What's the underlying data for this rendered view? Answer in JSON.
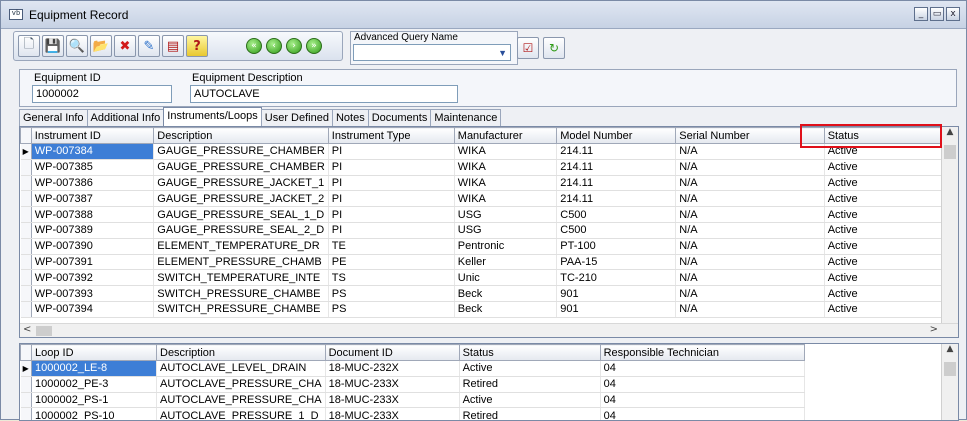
{
  "window": {
    "title": "Equipment Record",
    "app_icon": "vb",
    "minimize": "_",
    "restore": "▭",
    "close": "x"
  },
  "toolbar": {
    "buttons": [
      {
        "name": "new-icon",
        "glyph": "🗋"
      },
      {
        "name": "save-icon",
        "glyph": "💾"
      },
      {
        "name": "find-icon",
        "glyph": "🔍"
      },
      {
        "name": "open-folder-icon",
        "glyph": "📂"
      },
      {
        "name": "delete-icon",
        "glyph": "✖"
      },
      {
        "name": "edit-icon",
        "glyph": "✎"
      },
      {
        "name": "calculator-icon",
        "glyph": "▤"
      },
      {
        "name": "help-icon",
        "glyph": "?"
      }
    ],
    "nav": [
      {
        "name": "first-record-icon",
        "glyph": "«"
      },
      {
        "name": "previous-record-icon",
        "glyph": "‹"
      },
      {
        "name": "next-record-icon",
        "glyph": "›"
      },
      {
        "name": "last-record-icon",
        "glyph": "»"
      }
    ]
  },
  "query": {
    "label": "Advanced Query Name",
    "value": "",
    "arrow": "▼",
    "run_glyph": "☑",
    "refresh_glyph": "↻"
  },
  "header": {
    "equipment_id_label": "Equipment ID",
    "equipment_id": "1000002",
    "description_label": "Equipment Description",
    "description": "AUTOCLAVE"
  },
  "tabs": [
    "General Info",
    "Additional Info",
    "Instruments/Loops",
    "User Defined",
    "Notes",
    "Documents",
    "Maintenance"
  ],
  "active_tab": "Instruments/Loops",
  "instruments": {
    "columns": [
      "Instrument ID",
      "Description",
      "Instrument Type",
      "Manufacturer",
      "Model Number",
      "Serial Number",
      "Status"
    ],
    "rows": [
      [
        "WP-007384",
        "GAUGE_PRESSURE_CHAMBER",
        "PI",
        "WIKA",
        "214.11",
        "N/A",
        "Active"
      ],
      [
        "WP-007385",
        "GAUGE_PRESSURE_CHAMBER",
        "PI",
        "WIKA",
        "214.11",
        "N/A",
        "Active"
      ],
      [
        "WP-007386",
        "GAUGE_PRESSURE_JACKET_1",
        "PI",
        "WIKA",
        "214.11",
        "N/A",
        "Active"
      ],
      [
        "WP-007387",
        "GAUGE_PRESSURE_JACKET_2",
        "PI",
        "WIKA",
        "214.11",
        "N/A",
        "Active"
      ],
      [
        "WP-007388",
        "GAUGE_PRESSURE_SEAL_1_D",
        "PI",
        "USG",
        "C500",
        "N/A",
        "Active"
      ],
      [
        "WP-007389",
        "GAUGE_PRESSURE_SEAL_2_D",
        "PI",
        "USG",
        "C500",
        "N/A",
        "Active"
      ],
      [
        "WP-007390",
        "ELEMENT_TEMPERATURE_DR",
        "TE",
        "Pentronic",
        "PT-100",
        "N/A",
        "Active"
      ],
      [
        "WP-007391",
        "ELEMENT_PRESSURE_CHAMB",
        "PE",
        "Keller",
        "PAA-15",
        "N/A",
        "Active"
      ],
      [
        "WP-007392",
        "SWITCH_TEMPERATURE_INTE",
        "TS",
        "Unic",
        "TC-210",
        "N/A",
        "Active"
      ],
      [
        "WP-007393",
        "SWITCH_PRESSURE_CHAMBE",
        "PS",
        "Beck",
        "901",
        "N/A",
        "Active"
      ],
      [
        "WP-007394",
        "SWITCH_PRESSURE_CHAMBE",
        "PS",
        "Beck",
        "901",
        "N/A",
        "Active"
      ]
    ]
  },
  "loops": {
    "columns": [
      "Loop ID",
      "Description",
      "Document ID",
      "Status",
      "Responsible Technician"
    ],
    "rows": [
      [
        "1000002_LE-8",
        "AUTOCLAVE_LEVEL_DRAIN",
        "18-MUC-232X",
        "Active",
        "04"
      ],
      [
        "1000002_PE-3",
        "AUTOCLAVE_PRESSURE_CHA",
        "18-MUC-233X",
        "Retired",
        "04"
      ],
      [
        "1000002_PS-1",
        "AUTOCLAVE_PRESSURE_CHA",
        "18-MUC-233X",
        "Active",
        "04"
      ],
      [
        "1000002_PS-10",
        "AUTOCLAVE_PRESSURE_1_D",
        "18-MUC-233X",
        "Retired",
        "04"
      ]
    ]
  },
  "scroll": {
    "up": "▲",
    "down": "▼",
    "left": "<",
    "right": ">"
  },
  "row_marker": "▶"
}
